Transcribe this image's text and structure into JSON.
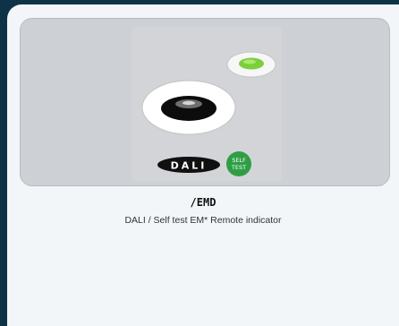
{
  "product": {
    "title": "/EMD",
    "description": "DALI / Self test EM* Remote indicator",
    "badges": {
      "dali": "DALI",
      "self_test_line1": "SELF",
      "self_test_line2": "TEST"
    }
  },
  "colors": {
    "page_background": "#0e3347",
    "card_background": "#f2f6f8",
    "indicator_green": "#7ccf3c",
    "self_test_badge": "#2e9e45"
  }
}
